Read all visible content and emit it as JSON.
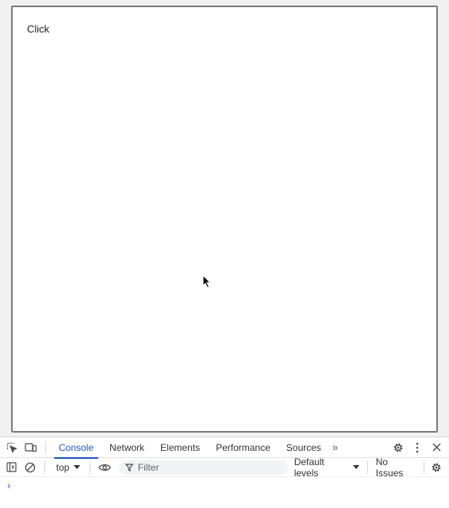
{
  "page": {
    "button_text": "Click"
  },
  "devtools": {
    "tabs": [
      {
        "label": "Console",
        "active": true
      },
      {
        "label": "Network",
        "active": false
      },
      {
        "label": "Elements",
        "active": false
      },
      {
        "label": "Performance",
        "active": false
      },
      {
        "label": "Sources",
        "active": false
      }
    ],
    "more_tabs": "»",
    "toolbar": {
      "context": "top",
      "filter_placeholder": "Filter",
      "levels": "Default levels",
      "issues": "No Issues"
    },
    "prompt_symbol": "›",
    "colors": {
      "accent": "#1a56c4",
      "frame_border": "#7a7a7a"
    },
    "icons": {
      "inspect": "inspect-element-icon",
      "device": "device-toolbar-icon",
      "settings": "gear-icon",
      "menu": "kebab-menu-icon",
      "close": "close-icon",
      "sidebar": "sidebar-toggle-icon",
      "clear": "clear-console-icon",
      "eye": "eye-icon",
      "filter": "filter-icon"
    }
  }
}
